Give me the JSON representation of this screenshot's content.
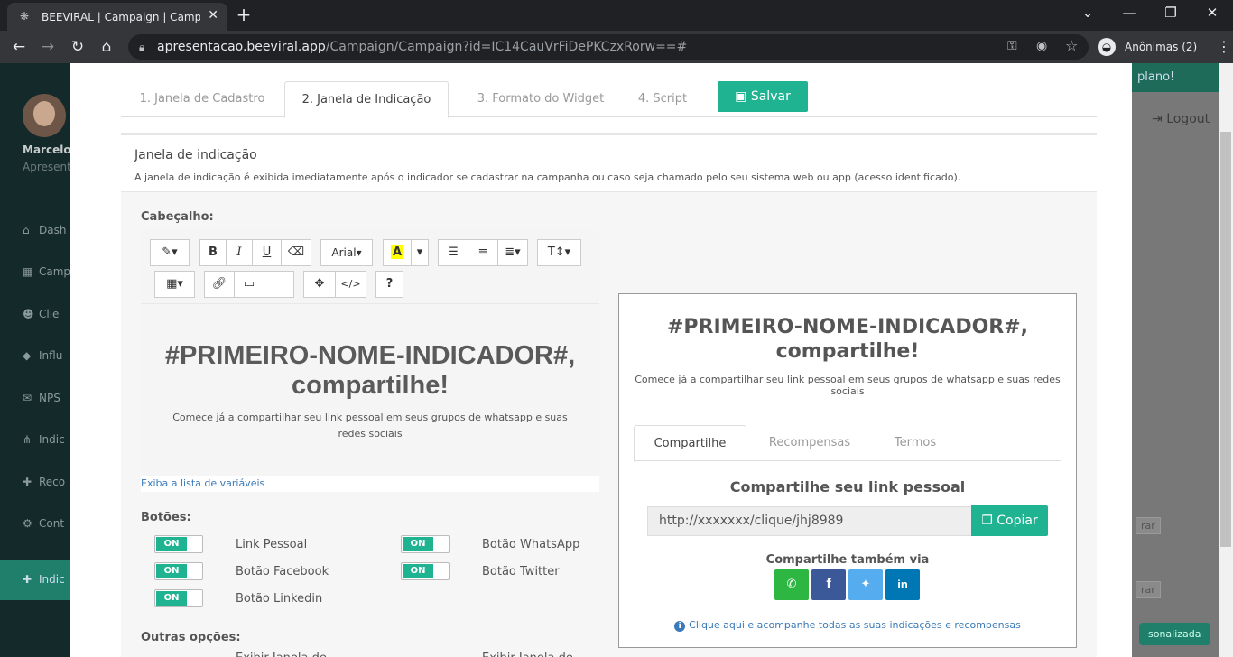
{
  "browser": {
    "tab_title": "BEEVIRAL | Campaign | Campaign",
    "url_host": "apresentacao.beeviral.app",
    "url_path": "/Campaign/Campaign?id=IC14CauVrFiDePKCzxRorw==#",
    "incognito_label": "Anônimas (2)"
  },
  "background": {
    "user_name": "Marcelo",
    "user_sub": "Apresent",
    "menu": [
      "Dash",
      "Camp",
      "Clie",
      "Influ",
      "NPS",
      "Indic",
      "Reco",
      "Cont",
      "Indic"
    ],
    "banner_text": "plano!",
    "logout": "Logout",
    "row_btn1": "rar",
    "row_btn2": "rar",
    "personal_btn": "sonalizada"
  },
  "modal": {
    "tabs": [
      "1. Janela de Cadastro",
      "2. Janela de Indicação",
      "3. Formato do Widget",
      "4. Script"
    ],
    "active_tab": 1,
    "save_label": "Salvar",
    "section_title": "Janela de indicação",
    "section_desc": "A janela de indicação é exibida imediatamente após o indicador se cadastrar na campanha ou caso seja chamado pelo seu sistema web ou app (acesso identificado).",
    "header_label": "Cabeçalho:",
    "editor": {
      "font_name": "Arial",
      "heading": "#PRIMEIRO-NOME-INDICADOR#, compartilhe!",
      "paragraph": "Comece já a compartilhar seu link pessoal em seus grupos de whatsapp e suas redes sociais"
    },
    "variables_link": "Exiba a lista de variáveis",
    "buttons_label": "Botões:",
    "toggle_on": "ON",
    "toggles": [
      {
        "label": "Link Pessoal",
        "on": true
      },
      {
        "label": "Botão WhatsApp",
        "on": true
      },
      {
        "label": "Botão Facebook",
        "on": true
      },
      {
        "label": "Botão Twitter",
        "on": true
      },
      {
        "label": "Botão Linkedin",
        "on": true
      }
    ],
    "other_label": "Outras opções:",
    "other_cut1": "Exibir Janela de",
    "other_cut2": "Exibir Janela de"
  },
  "preview": {
    "heading": "#PRIMEIRO-NOME-INDICADOR#, compartilhe!",
    "paragraph": "Comece já a compartilhar seu link pessoal em seus grupos de whatsapp e suas redes sociais",
    "tabs": [
      "Compartilhe",
      "Recompensas",
      "Termos"
    ],
    "subtitle": "Compartilhe seu link pessoal",
    "link": "http://xxxxxxx/clique/jhj8989",
    "copy_label": "Copiar",
    "share_via": "Compartilhe também via",
    "social": [
      "whatsapp",
      "facebook",
      "twitter",
      "linkedin"
    ],
    "info_link": "Clique aqui e acompanhe todas as suas indicações e recompensas"
  },
  "colors": {
    "accent": "#1fb391",
    "whatsapp": "#2db742",
    "facebook": "#3b5998",
    "twitter": "#55acee",
    "linkedin": "#0077b5"
  }
}
